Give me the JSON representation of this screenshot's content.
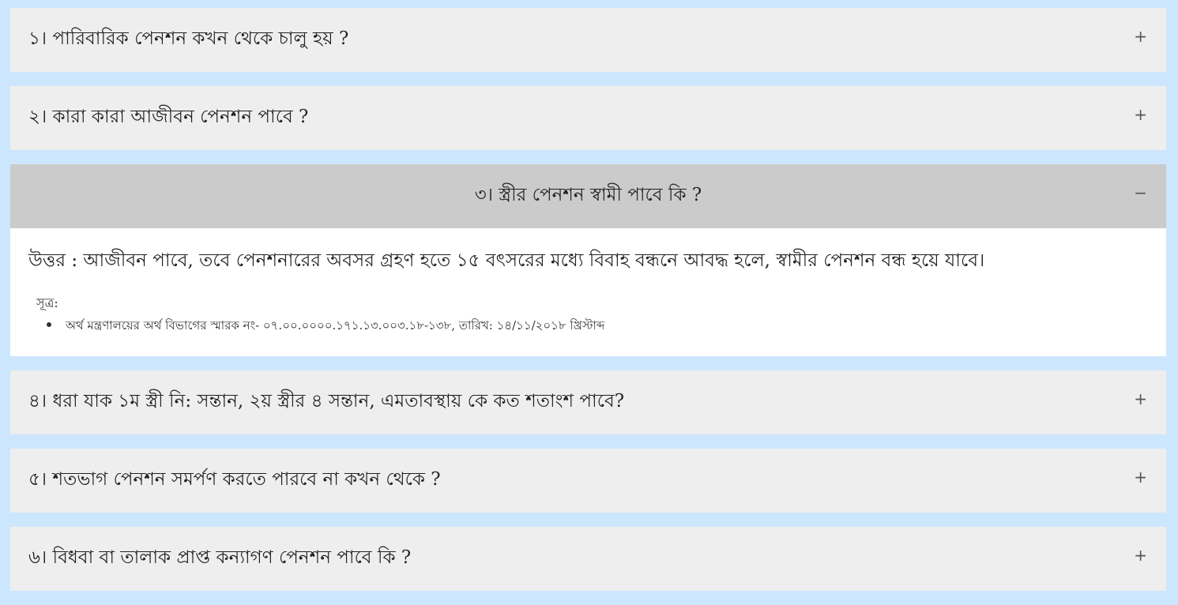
{
  "faq": {
    "items": [
      {
        "question": "১। পারিবারিক পেনশন কখন থেকে চালু হয় ?",
        "icon": "+"
      },
      {
        "question": "২। কারা কারা আজীবন পেনশন পাবে ?",
        "icon": "+"
      },
      {
        "question": "৩। স্ত্রীর পেনশন স্বামী পাবে কি ?",
        "icon": "−",
        "expanded": true,
        "answer": "উত্তর : আজীবন পাবে, তবে পেনশনারের অবসর গ্রহণ হতে ১৫ বৎসরের মধ্যে বিবাহ বন্ধনে আবদ্ধ হলে, স্বামীর পেনশন বন্ধ হয়ে যাবে।",
        "source_label": "সূত্র:",
        "sources": [
          "অর্থ মন্ত্রণালয়ের অর্থ বিভাগের স্মারক নং- ০৭.০০.০০০০.১৭১.১৩.০০৩.১৮-১৩৮, তারিখ: ১৪/১১/২০১৮ খ্রিস্টাব্দ"
        ]
      },
      {
        "question": "৪। ধরা যাক ১ম স্ত্রী নি: সন্তান, ২য় স্ত্রীর ৪ সন্তান, এমতাবস্থায় কে কত শতাংশ পাবে?",
        "icon": "+"
      },
      {
        "question": "৫। শতভাগ পেনশন সমর্পণ করতে পারবে না কখন থেকে ?",
        "icon": "+"
      },
      {
        "question": "৬। বিধবা বা তালাক প্রাপ্ত কন্যাগণ পেনশন পাবে কি ?",
        "icon": "+"
      }
    ]
  },
  "colors": {
    "page_background": "#cce6fe",
    "header_background": "#eeeeee",
    "active_header_background": "#cbcbcb",
    "answer_background": "#ffffff"
  }
}
